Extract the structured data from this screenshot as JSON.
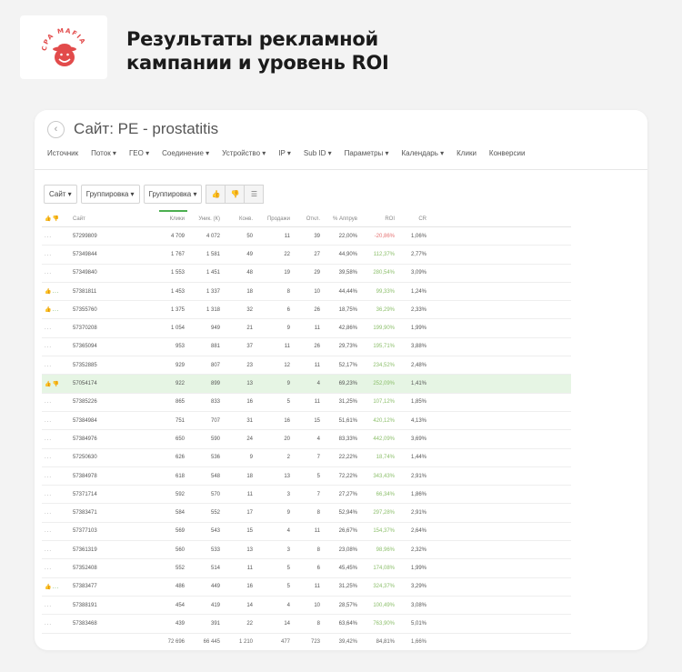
{
  "brand": {
    "logo_text": "CPA MAFIA"
  },
  "headline": {
    "line1": "Результаты рекламной",
    "line2": "кампании и уровень ROI"
  },
  "page": {
    "back_icon": "chevron-left-icon",
    "title": "Сайт: PE - prostatitis"
  },
  "menu": [
    "Источник",
    "Поток ▾",
    "ГЕО ▾",
    "Соединение ▾",
    "Устройство ▾",
    "IP ▾",
    "Sub ID ▾",
    "Параметры ▾",
    "Календарь ▾",
    "Клики",
    "Конверсии"
  ],
  "toolbar": {
    "select1": "Сайт ▾",
    "select2": "Группировка ▾",
    "select3": "Группировка ▾",
    "icons": [
      "thumb-up-icon",
      "thumb-down-icon",
      "menu-icon"
    ]
  },
  "table": {
    "headers": [
      "Сайт",
      "Клики",
      "Уник. (К)",
      "Конв.",
      "Продажи",
      "Откл.",
      "% Аппрув",
      "ROI",
      "CR"
    ],
    "rows": [
      {
        "icon": "...",
        "site": "57299809",
        "clicks": "4 709",
        "uniq": "4 072",
        "conv": "50",
        "sales": "11",
        "rej": "39",
        "approve": "22,00%",
        "roi": "-20,86%",
        "cr": "1,06%"
      },
      {
        "icon": "...",
        "site": "57349844",
        "clicks": "1 767",
        "uniq": "1 581",
        "conv": "49",
        "sales": "22",
        "rej": "27",
        "approve": "44,90%",
        "roi": "112,37%",
        "cr": "2,77%"
      },
      {
        "icon": "...",
        "site": "57349840",
        "clicks": "1 553",
        "uniq": "1 451",
        "conv": "48",
        "sales": "19",
        "rej": "29",
        "approve": "39,58%",
        "roi": "280,54%",
        "cr": "3,09%"
      },
      {
        "icon": "👍...",
        "site": "57381811",
        "clicks": "1 453",
        "uniq": "1 337",
        "conv": "18",
        "sales": "8",
        "rej": "10",
        "approve": "44,44%",
        "roi": "99,33%",
        "cr": "1,24%"
      },
      {
        "icon": "👍...",
        "site": "57355760",
        "clicks": "1 375",
        "uniq": "1 318",
        "conv": "32",
        "sales": "6",
        "rej": "26",
        "approve": "18,75%",
        "roi": "36,29%",
        "cr": "2,33%"
      },
      {
        "icon": "...",
        "site": "57370208",
        "clicks": "1 054",
        "uniq": "949",
        "conv": "21",
        "sales": "9",
        "rej": "11",
        "approve": "42,86%",
        "roi": "199,90%",
        "cr": "1,99%"
      },
      {
        "icon": "...",
        "site": "57365094",
        "clicks": "953",
        "uniq": "881",
        "conv": "37",
        "sales": "11",
        "rej": "26",
        "approve": "29,73%",
        "roi": "195,71%",
        "cr": "3,88%"
      },
      {
        "icon": "...",
        "site": "57352885",
        "clicks": "929",
        "uniq": "807",
        "conv": "23",
        "sales": "12",
        "rej": "11",
        "approve": "52,17%",
        "roi": "234,52%",
        "cr": "2,48%"
      },
      {
        "icon": "👍👎",
        "site": "57054174",
        "clicks": "922",
        "uniq": "899",
        "conv": "13",
        "sales": "9",
        "rej": "4",
        "approve": "69,23%",
        "roi": "252,09%",
        "cr": "1,41%"
      },
      {
        "icon": "...",
        "site": "57385226",
        "clicks": "865",
        "uniq": "833",
        "conv": "16",
        "sales": "5",
        "rej": "11",
        "approve": "31,25%",
        "roi": "107,12%",
        "cr": "1,85%"
      },
      {
        "icon": "...",
        "site": "57384984",
        "clicks": "751",
        "uniq": "707",
        "conv": "31",
        "sales": "16",
        "rej": "15",
        "approve": "51,61%",
        "roi": "420,12%",
        "cr": "4,13%"
      },
      {
        "icon": "...",
        "site": "57384976",
        "clicks": "650",
        "uniq": "590",
        "conv": "24",
        "sales": "20",
        "rej": "4",
        "approve": "83,33%",
        "roi": "442,09%",
        "cr": "3,69%"
      },
      {
        "icon": "...",
        "site": "57250630",
        "clicks": "626",
        "uniq": "536",
        "conv": "9",
        "sales": "2",
        "rej": "7",
        "approve": "22,22%",
        "roi": "18,74%",
        "cr": "1,44%"
      },
      {
        "icon": "...",
        "site": "57384978",
        "clicks": "618",
        "uniq": "548",
        "conv": "18",
        "sales": "13",
        "rej": "5",
        "approve": "72,22%",
        "roi": "343,43%",
        "cr": "2,91%"
      },
      {
        "icon": "...",
        "site": "57371714",
        "clicks": "592",
        "uniq": "570",
        "conv": "11",
        "sales": "3",
        "rej": "7",
        "approve": "27,27%",
        "roi": "66,34%",
        "cr": "1,86%"
      },
      {
        "icon": "...",
        "site": "57383471",
        "clicks": "584",
        "uniq": "552",
        "conv": "17",
        "sales": "9",
        "rej": "8",
        "approve": "52,94%",
        "roi": "297,28%",
        "cr": "2,91%"
      },
      {
        "icon": "...",
        "site": "57377103",
        "clicks": "569",
        "uniq": "543",
        "conv": "15",
        "sales": "4",
        "rej": "11",
        "approve": "26,67%",
        "roi": "154,37%",
        "cr": "2,64%"
      },
      {
        "icon": "...",
        "site": "57361319",
        "clicks": "560",
        "uniq": "533",
        "conv": "13",
        "sales": "3",
        "rej": "8",
        "approve": "23,08%",
        "roi": "98,96%",
        "cr": "2,32%"
      },
      {
        "icon": "...",
        "site": "57352408",
        "clicks": "552",
        "uniq": "514",
        "conv": "11",
        "sales": "5",
        "rej": "6",
        "approve": "45,45%",
        "roi": "174,08%",
        "cr": "1,99%"
      },
      {
        "icon": "👍...",
        "site": "57383477",
        "clicks": "486",
        "uniq": "449",
        "conv": "16",
        "sales": "5",
        "rej": "11",
        "approve": "31,25%",
        "roi": "324,37%",
        "cr": "3,29%"
      },
      {
        "icon": "...",
        "site": "57388191",
        "clicks": "454",
        "uniq": "419",
        "conv": "14",
        "sales": "4",
        "rej": "10",
        "approve": "28,57%",
        "roi": "100,49%",
        "cr": "3,08%"
      },
      {
        "icon": "...",
        "site": "57383468",
        "clicks": "439",
        "uniq": "391",
        "conv": "22",
        "sales": "14",
        "rej": "8",
        "approve": "63,64%",
        "roi": "763,90%",
        "cr": "5,01%"
      }
    ],
    "total": {
      "clicks": "72 696",
      "uniq": "66 445",
      "conv": "1 210",
      "sales": "477",
      "rej": "723",
      "approve": "39,42%",
      "roi": "84,81%",
      "cr": "1,66%"
    }
  },
  "colors": {
    "accent_green": "#4caf50",
    "roi_positive": "#8cbf6b",
    "roi_negative": "#e57373",
    "highlight_row": "#e6f5e4",
    "logo_red": "#e24b4b"
  }
}
